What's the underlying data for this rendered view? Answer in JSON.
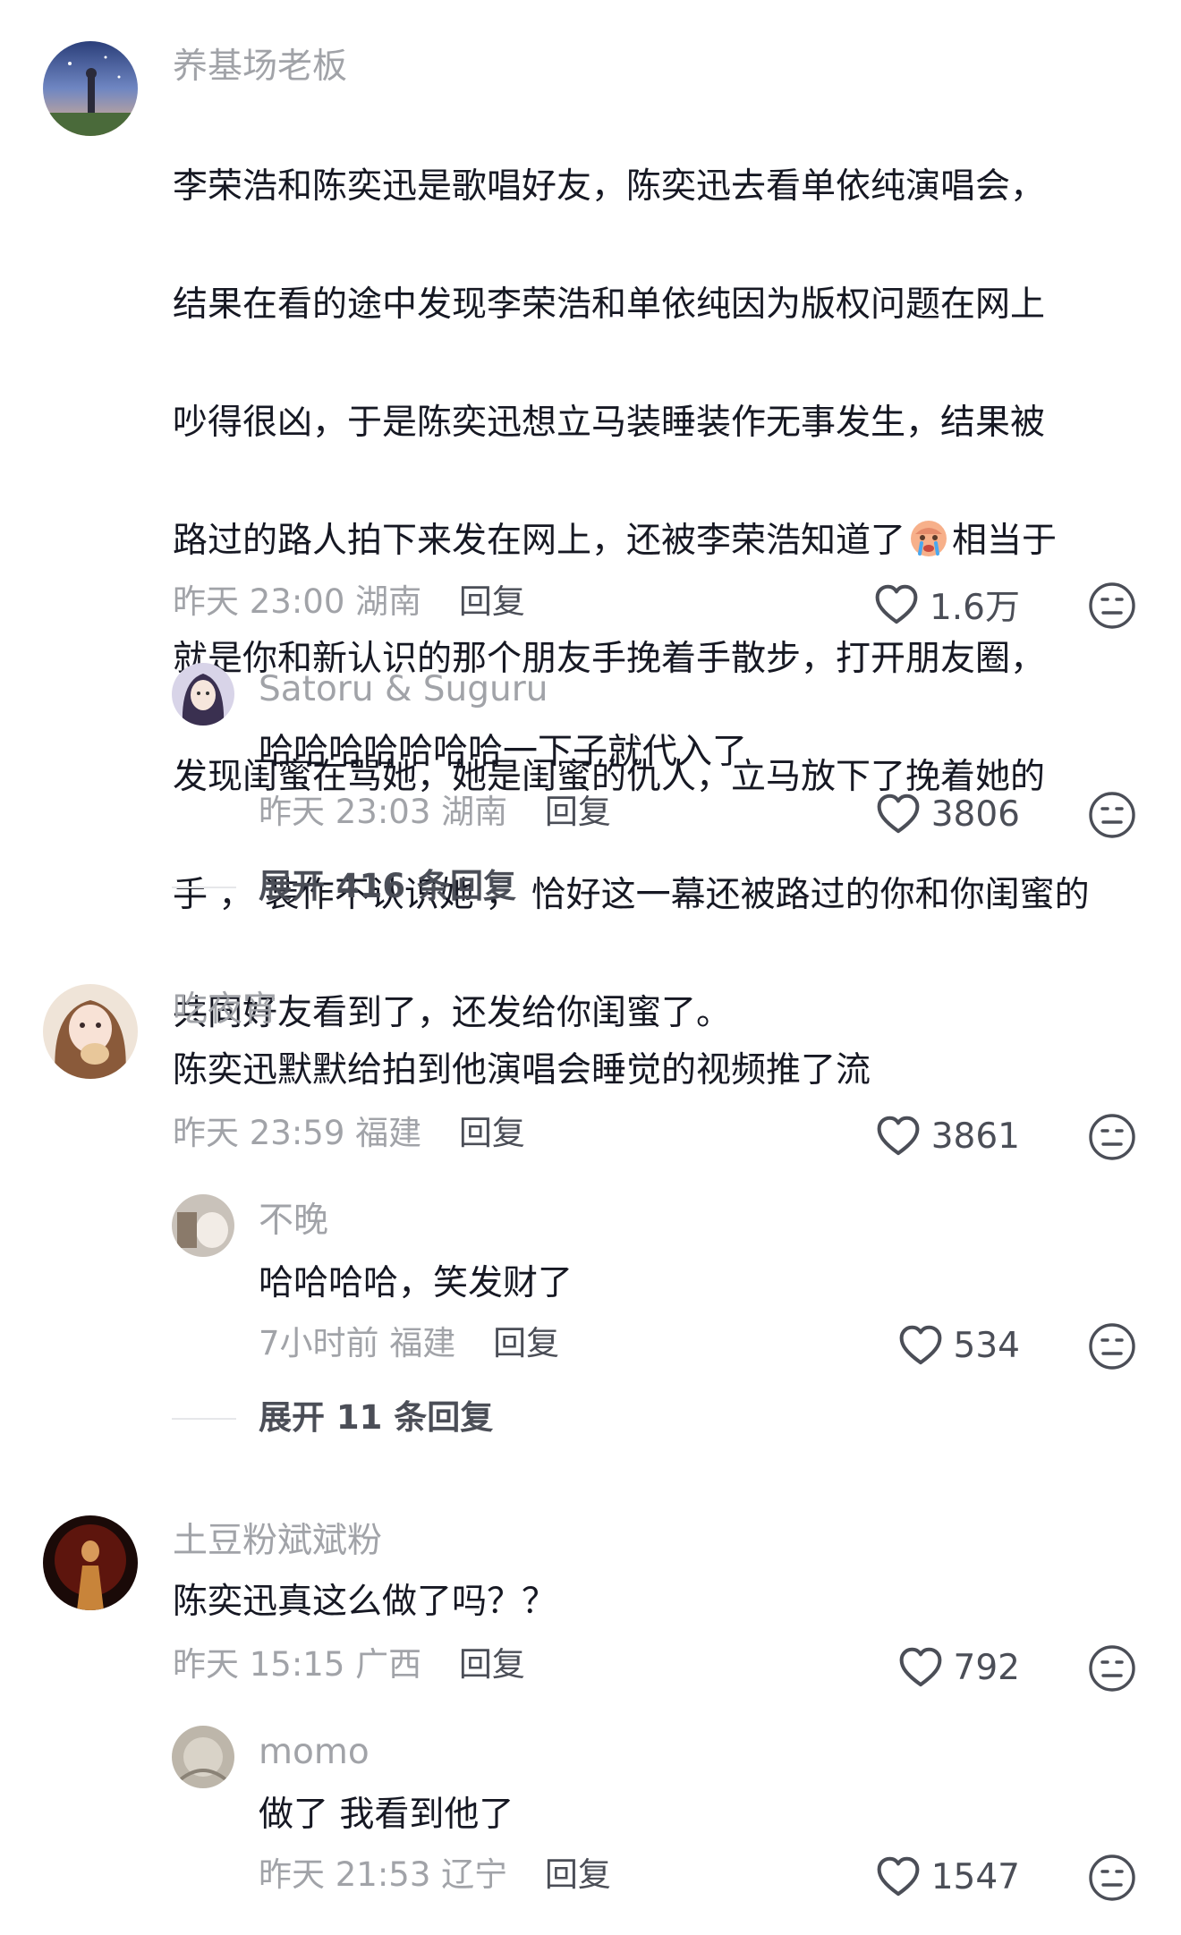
{
  "comments": [
    {
      "username": "养基场老板",
      "text_lines": [
        "李荣浩和陈奕迅是歌唱好友，陈奕迅去看单依纯演唱会，",
        "结果在看的途中发现李荣浩和单依纯因为版权问题在网上",
        "吵得很凶，于是陈奕迅想立马装睡装作无事发生，结果被",
        "路过的路人拍下来发在网上，还被李荣浩知道了",
        "相当于",
        "就是你和新认识的那个朋友手挽着手散步，打开朋友圈，",
        "发现闺蜜在骂她，她是闺蜜的仇人，立马放下了挽着她的",
        "手 ， 装作不认识她 ， 恰好这一幕还被路过的你和你闺蜜的",
        "共同好友看到了，还发给你闺蜜了。"
      ],
      "emoji": "crying-face-emoji",
      "time": "昨天 23:00",
      "location": "湖南",
      "reply_label": "回复",
      "likes": "1.6万",
      "reply": {
        "username": "Satoru & Suguru",
        "text": "哈哈哈哈哈哈哈一下子就代入了",
        "time": "昨天 23:03",
        "location": "湖南",
        "reply_label": "回复",
        "likes": "3806"
      },
      "expand": "展开 416 条回复"
    },
    {
      "username": "吃夜宵",
      "text": "陈奕迅默默给拍到他演唱会睡觉的视频推了流",
      "time": "昨天 23:59",
      "location": "福建",
      "reply_label": "回复",
      "likes": "3861",
      "reply": {
        "username": "不晚",
        "text": "哈哈哈哈，笑发财了",
        "time": "7小时前",
        "location": "福建",
        "reply_label": "回复",
        "likes": "534"
      },
      "expand": "展开 11 条回复"
    },
    {
      "username": "土豆粉斌斌粉",
      "text": "陈奕迅真这么做了吗？？",
      "time": "昨天 15:15",
      "location": "广西",
      "reply_label": "回复",
      "likes": "792",
      "reply": {
        "username": "momo",
        "text": "做了 我看到他了",
        "time": "昨天 21:53",
        "location": "辽宁",
        "reply_label": "回复",
        "likes": "1547"
      }
    }
  ],
  "icons": {
    "like": "heart-outline-icon",
    "dislike": "neutral-face-icon"
  },
  "colors": {
    "text": "#161823",
    "secondary": "#a1a3a8",
    "action": "#4b4e57"
  }
}
